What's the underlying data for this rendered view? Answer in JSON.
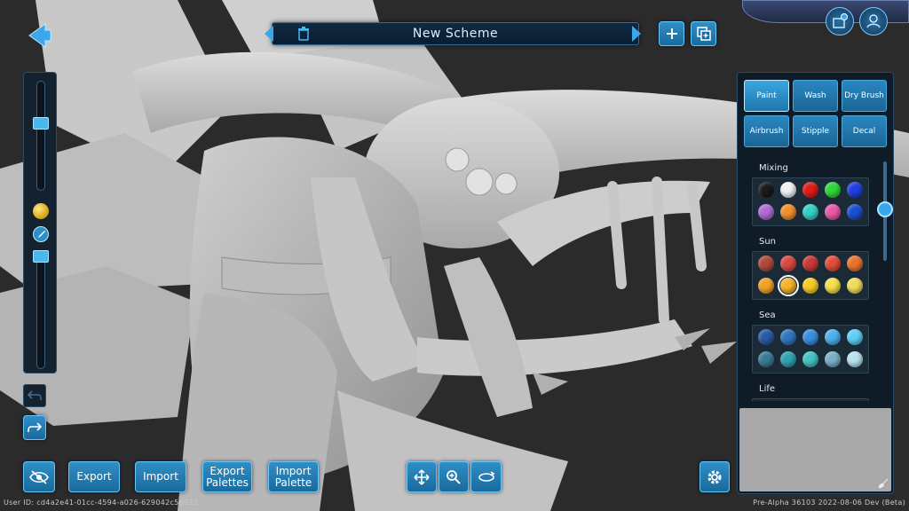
{
  "scheme": {
    "title": "New Scheme"
  },
  "toolbar": {
    "export_label": "Export",
    "import_label": "Import",
    "export_palettes_label": "Export Palettes",
    "import_palette_label": "Import Palette"
  },
  "modes": [
    {
      "label": "Paint",
      "active": true
    },
    {
      "label": "Wash",
      "active": false
    },
    {
      "label": "Dry Brush",
      "active": false
    },
    {
      "label": "Airbrush",
      "active": false
    },
    {
      "label": "Stipple",
      "active": false
    },
    {
      "label": "Decal",
      "active": false
    }
  ],
  "palettes": [
    {
      "name": "Mixing",
      "rows": [
        [
          "#1a1a1a",
          "#f2f2f2",
          "#e01a1a",
          "#2fd63a",
          "#1f3fe0"
        ],
        [
          "#b06bd6",
          "#f2902e",
          "#36d1c4",
          "#e85aa8",
          "#1a4fd0"
        ]
      ]
    },
    {
      "name": "Sun",
      "rows": [
        [
          "#b04a3a",
          "#d84a42",
          "#c83a36",
          "#e04e3a",
          "#e8742e"
        ],
        [
          "#f0a22a",
          "#f5b52a",
          "#f5cc26",
          "#f5e04a",
          "#f0dc5a"
        ]
      ]
    },
    {
      "name": "Sea",
      "rows": [
        [
          "#2a5aa6",
          "#2f78c0",
          "#3a8ee0",
          "#4cb0ee",
          "#5cd0f5"
        ],
        [
          "#3a7a96",
          "#2fa3b0",
          "#46c2c4",
          "#7ab0c6",
          "#b8e2ee"
        ]
      ]
    },
    {
      "name": "Life",
      "rows": [
        [
          "#2e7a32",
          "#3e9a3a",
          "#7aa83a",
          "#9ac43e",
          "#c4d862"
        ]
      ]
    }
  ],
  "selected_swatch": {
    "palette": "Sun",
    "row": 1,
    "col": 1
  },
  "footer": {
    "user_id": "User ID: cd4a2e41-01cc-4594-a026-629042c56922",
    "build": "Pre-Alpha 36103 2022-08-06 Dev (Beta)"
  },
  "icons": {
    "back": "back-arrow-icon",
    "delete": "trash-icon",
    "add": "plus-icon",
    "duplicate": "duplicate-icon",
    "color": "color-ball-icon",
    "brush": "brush-icon",
    "undo": "undo-icon",
    "redo": "redo-icon",
    "visibility": "eye-slash-icon",
    "move": "move-icon",
    "zoom": "zoom-icon",
    "rotate": "rotate-icon",
    "settings": "gear-icon",
    "eraser": "broom-icon"
  },
  "colors": {
    "accent": "#2f8fc7",
    "panel": "#0f1b27",
    "highlight": "#66c7ff"
  }
}
